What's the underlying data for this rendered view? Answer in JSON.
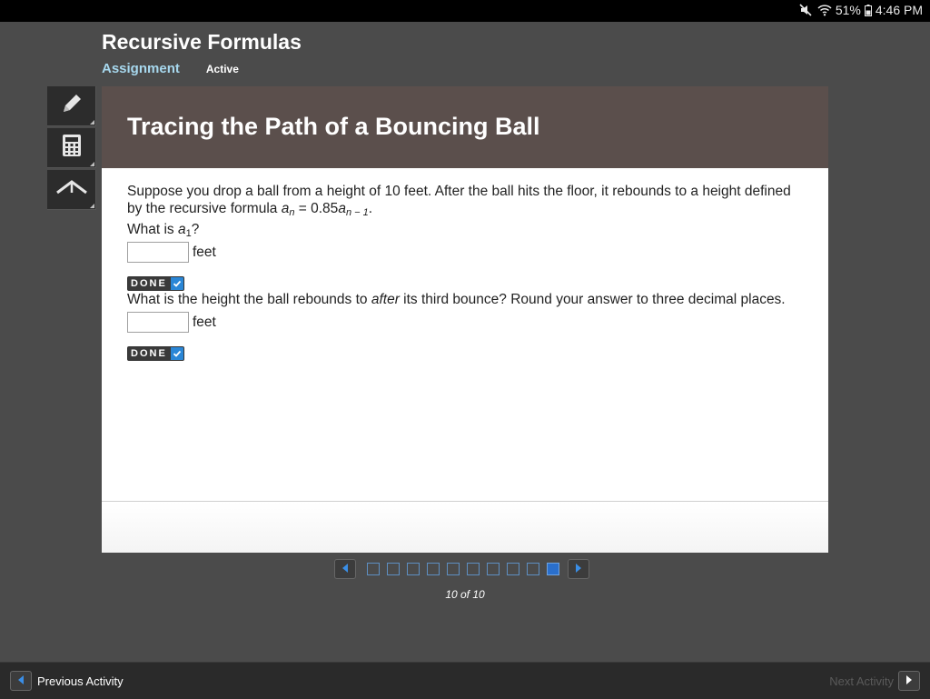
{
  "status_bar": {
    "battery": "51%",
    "time": "4:46 PM",
    "icons": [
      "mute-icon",
      "wifi-icon",
      "battery-icon"
    ]
  },
  "header": {
    "title": "Recursive Formulas",
    "assignment_label": "Assignment",
    "status": "Active"
  },
  "toolbar": {
    "tools": [
      "pencil-icon",
      "calculator-icon",
      "highlighter-icon"
    ]
  },
  "panel": {
    "title": "Tracing the Path of a Bouncing Ball",
    "intro_text": "Suppose you drop a ball from a height of 10 feet. After the ball hits the floor, it rebounds to a height defined by the recursive formula",
    "formula": {
      "lhs_var": "a",
      "lhs_sub": "n",
      "equals": " = 0.85",
      "rhs_var": "a",
      "rhs_sub": "n − 1",
      "end": "."
    },
    "q1": {
      "prefix": "What is ",
      "var": "a",
      "sub": "1",
      "suffix": "?",
      "input_value": "",
      "unit": "feet",
      "done_label": "DONE"
    },
    "q2": {
      "before": "What is the height the ball rebounds to ",
      "emph": "after",
      "after": " its third bounce? Round your answer to three decimal places.",
      "input_value": "",
      "unit": "feet",
      "done_label": "DONE"
    }
  },
  "pager": {
    "total_squares": 10,
    "active_index": 10,
    "label": "10 of 10"
  },
  "footer": {
    "prev_label": "Previous Activity",
    "next_label": "Next Activity"
  },
  "colors": {
    "page_bg": "#4b4b4b",
    "header_bg": "#5b4f4c",
    "accent": "#a7d8ee",
    "active_square": "#2a6fcc"
  }
}
